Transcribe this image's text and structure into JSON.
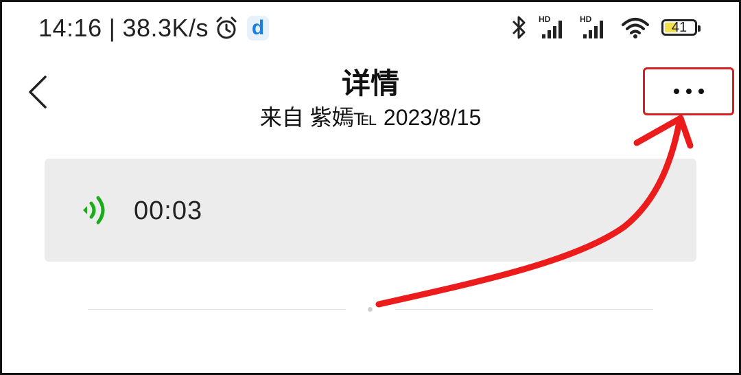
{
  "status_bar": {
    "time": "14:16",
    "separator": "|",
    "net_speed": "38.3K/s",
    "battery_level": "41",
    "battery_percent": 41,
    "icons": [
      "alarm-icon",
      "app-d-icon",
      "bluetooth-icon",
      "hd-signal-icon",
      "hd-signal-icon",
      "wifi-icon",
      "battery-icon"
    ],
    "app_letter": "d"
  },
  "header": {
    "title": "详情",
    "subtitle": "来自 紫嫣℡ 2023/8/15",
    "back_icon": "chevron-left-icon",
    "more_icon": "more-horizontal-icon"
  },
  "voice_message": {
    "icon": "voice-wave-icon",
    "duration": "00:03",
    "icon_color": "#1aad19"
  },
  "annotation": {
    "highlight_color": "#d62020"
  }
}
